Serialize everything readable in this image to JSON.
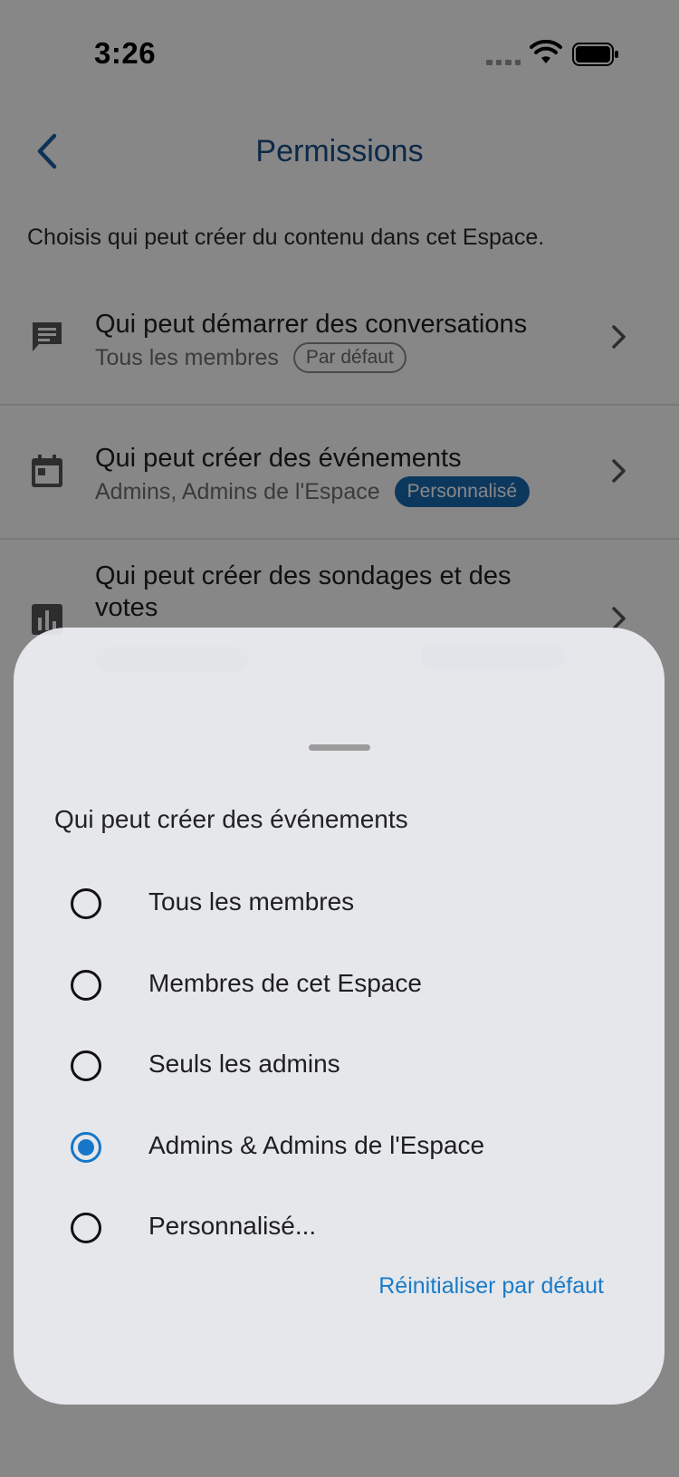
{
  "status_bar": {
    "time": "3:26"
  },
  "nav": {
    "title": "Permissions"
  },
  "description": "Choisis qui peut créer du contenu dans cet Espace.",
  "permissions": [
    {
      "title": "Qui peut démarrer des conversations",
      "subtitle": "Tous les membres",
      "badge": "Par défaut",
      "icon": "chat-bubble-icon"
    },
    {
      "title": "Qui peut créer des événements",
      "subtitle": "Admins, Admins de l'Espace",
      "badge": "Personnalisé",
      "icon": "calendar-icon"
    },
    {
      "title_line1": "Qui peut créer des sondages et des",
      "title_line2": "votes",
      "icon": "bar-chart-icon"
    }
  ],
  "sheet": {
    "title": "Qui peut créer des événements",
    "options": [
      {
        "label": "Tous les membres",
        "selected": false
      },
      {
        "label": "Membres de cet Espace",
        "selected": false
      },
      {
        "label": "Seuls les admins",
        "selected": false
      },
      {
        "label": "Admins & Admins de l'Espace",
        "selected": true
      },
      {
        "label": "Personnalisé...",
        "selected": false
      }
    ],
    "reset_label": "Réinitialiser par défaut"
  },
  "colors": {
    "accent": "#1677c8",
    "title": "#1a4e86",
    "badge": "#1a6bb2"
  }
}
